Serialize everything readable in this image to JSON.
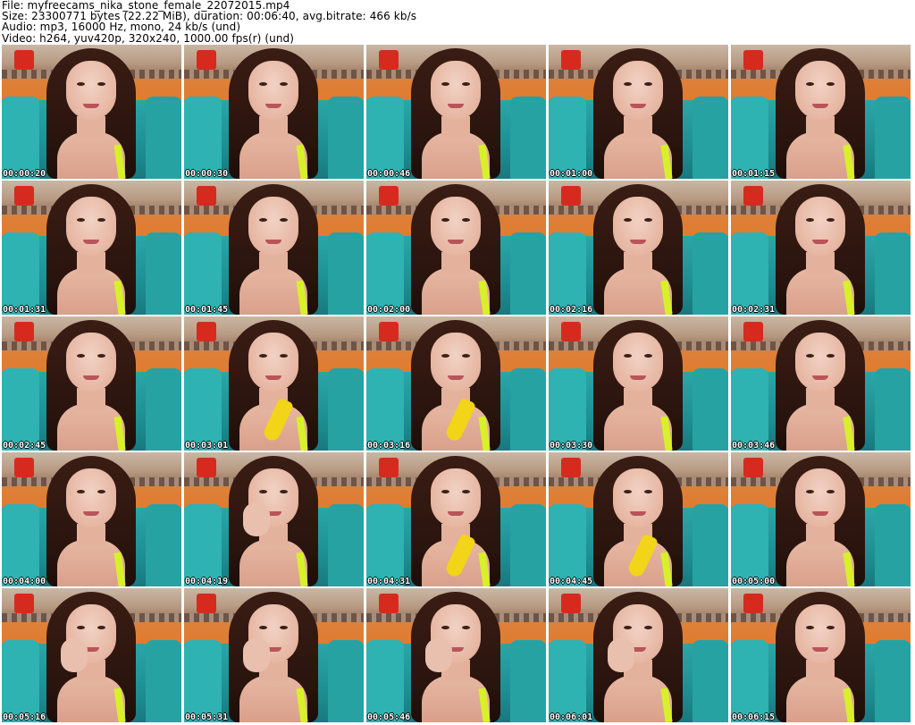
{
  "header": {
    "file_line": "File: myfreecams_nika_stone_female_22072015.mp4",
    "size_line": "Size: 23300771 bytes (22.22 MiB), duration: 00:06:40, avg.bitrate: 466 kb/s",
    "audio_line": "Audio: mp3, 16000 Hz, mono, 24 kb/s (und)",
    "video_line": "Video: h264, yuv420p, 320x240, 1000.00 fps(r) (und)"
  },
  "thumbnails": [
    {
      "timestamp": "00:00:20"
    },
    {
      "timestamp": "00:00:30"
    },
    {
      "timestamp": "00:00:46"
    },
    {
      "timestamp": "00:01:00"
    },
    {
      "timestamp": "00:01:15"
    },
    {
      "timestamp": "00:01:31"
    },
    {
      "timestamp": "00:01:45"
    },
    {
      "timestamp": "00:02:00"
    },
    {
      "timestamp": "00:02:16"
    },
    {
      "timestamp": "00:02:31"
    },
    {
      "timestamp": "00:02:45"
    },
    {
      "timestamp": "00:03:01"
    },
    {
      "timestamp": "00:03:16"
    },
    {
      "timestamp": "00:03:30"
    },
    {
      "timestamp": "00:03:46"
    },
    {
      "timestamp": "00:04:00"
    },
    {
      "timestamp": "00:04:19"
    },
    {
      "timestamp": "00:04:31"
    },
    {
      "timestamp": "00:04:45"
    },
    {
      "timestamp": "00:05:00"
    },
    {
      "timestamp": "00:05:16"
    },
    {
      "timestamp": "00:05:31"
    },
    {
      "timestamp": "00:05:46"
    },
    {
      "timestamp": "00:06:01"
    },
    {
      "timestamp": "00:06:15"
    }
  ],
  "colors": {
    "background": "#ffffff",
    "wall": "#e07a2e",
    "chair": "#1d8f93",
    "hair": "#2a140e",
    "top_strap": "#d8f02a",
    "banana": "#f2d419"
  }
}
